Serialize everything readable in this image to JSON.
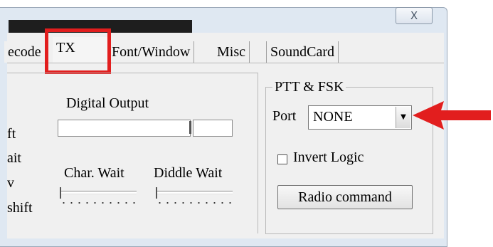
{
  "window": {
    "close_glyph": "X"
  },
  "tabs": [
    {
      "label": "ecode",
      "selected": false
    },
    {
      "label": "TX",
      "selected": true
    },
    {
      "label": "Font/Window",
      "selected": false
    },
    {
      "label": "Misc",
      "selected": false
    },
    {
      "label": "SoundCard",
      "selected": false
    }
  ],
  "tx_panel": {
    "left_labels": [
      "ft",
      "ait",
      "v",
      "shift"
    ],
    "digital_output_label": "Digital Output",
    "char_wait_label": "Char. Wait",
    "diddle_wait_label": "Diddle Wait"
  },
  "ptt_group": {
    "title": "PTT & FSK",
    "port_label": "Port",
    "port_value": "NONE",
    "invert_logic_label": "Invert Logic",
    "invert_logic_checked": false,
    "radio_command_label": "Radio command"
  },
  "colors": {
    "highlight": "#e21e1e",
    "arrow": "#e21e1e"
  }
}
